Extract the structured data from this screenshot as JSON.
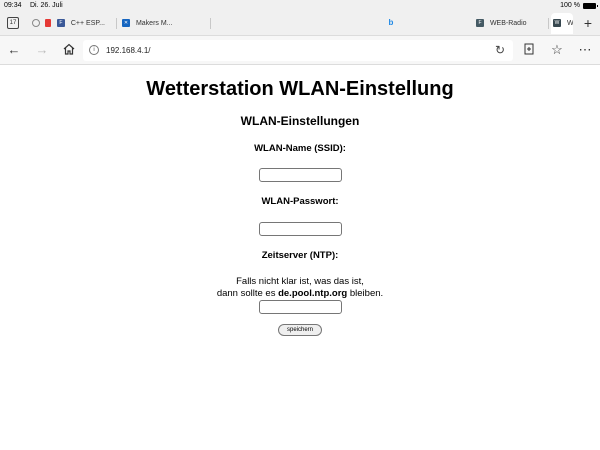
{
  "statusbar": {
    "time": "09:34",
    "date": "Di. 26. Juli",
    "battery": "100 %"
  },
  "tabs": {
    "counter": "17",
    "items": [
      {
        "label": "C++ ESP...",
        "icon": "tab-favicon"
      },
      {
        "label": "Makers M...",
        "icon": "tab-favicon"
      },
      {
        "label": "",
        "icon": "bing-icon"
      },
      {
        "label": "WEB-Radio",
        "icon": "tab-favicon"
      },
      {
        "label": "W",
        "icon": "tab-favicon"
      }
    ],
    "new_tab": "+"
  },
  "addressbar": {
    "url": "192.168.4.1/"
  },
  "page": {
    "title": "Wetterstation WLAN-Einstellung",
    "subtitle": "WLAN-Einstellungen",
    "ssid_label": "WLAN-Name (SSID):",
    "ssid_value": "",
    "password_label": "WLAN-Passwort:",
    "password_value": "",
    "ntp_label": "Zeitserver (NTP):",
    "ntp_note_line1": "Falls nicht klar ist, was das ist,",
    "ntp_note_pre": "dann sollte es ",
    "ntp_note_bold": "de.pool.ntp.org",
    "ntp_note_post": " bleiben.",
    "ntp_value": "",
    "save_label": "speichern"
  }
}
